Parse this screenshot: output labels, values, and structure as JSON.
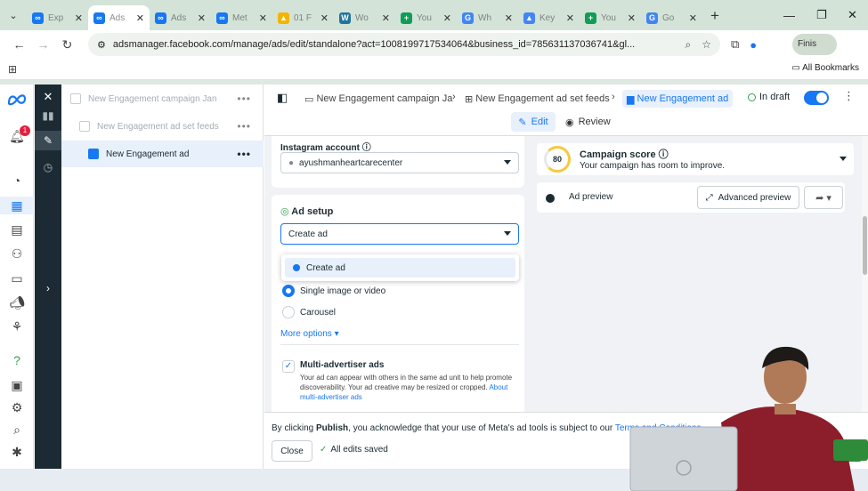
{
  "browser": {
    "tabs": [
      {
        "label": "Exp",
        "color": "#1877f2",
        "glyph": "∞"
      },
      {
        "label": "Ads",
        "color": "#1877f2",
        "glyph": "∞",
        "active": true
      },
      {
        "label": "Ads",
        "color": "#1877f2",
        "glyph": "∞"
      },
      {
        "label": "Met",
        "color": "#1877f2",
        "glyph": "∞"
      },
      {
        "label": "01 F",
        "color": "#f4b400",
        "glyph": "▲"
      },
      {
        "label": "Wo",
        "color": "#21759b",
        "glyph": "W"
      },
      {
        "label": "You",
        "color": "#0f9d58",
        "glyph": "+"
      },
      {
        "label": "Wh",
        "color": "#4285f4",
        "glyph": "G"
      },
      {
        "label": "Key",
        "color": "#4285f4",
        "glyph": "▲"
      },
      {
        "label": "You",
        "color": "#0f9d58",
        "glyph": "+"
      },
      {
        "label": "Go",
        "color": "#4285f4",
        "glyph": "G"
      }
    ],
    "url": "adsmanager.facebook.com/manage/ads/edit/standalone?act=1008199717534064&business_id=785631137036741&gl...",
    "finish_label": "Finis",
    "all_bookmarks": "All Bookmarks"
  },
  "tree": {
    "items": [
      {
        "label": "New Engagement campaign Jan"
      },
      {
        "label": "New Engagement ad set feeds"
      },
      {
        "label": "New Engagement ad"
      }
    ]
  },
  "nav": {
    "notification_count": "1"
  },
  "header": {
    "crumbs": [
      "New Engagement campaign Ja",
      "New Engagement ad set feeds",
      "New Engagement ad"
    ],
    "status": "In draft",
    "edit_tab": "Edit",
    "review_tab": "Review"
  },
  "form": {
    "instagram_label": "Instagram account",
    "instagram_value": "ayushmanheartcarecenter",
    "ad_setup_title": "Ad setup",
    "ad_setup_select": "Create ad",
    "dropdown_option": "Create ad",
    "format_single": "Single image or video",
    "format_carousel": "Carousel",
    "more_options": "More options",
    "multi_adv_label": "Multi-advertiser ads",
    "multi_adv_desc": "Your ad can appear with others in the same ad unit to help promote discoverability. Your ad creative may be resized or cropped.",
    "multi_adv_link": "About multi-advertiser ads"
  },
  "preview": {
    "score": "80",
    "score_title": "Campaign score",
    "score_sub": "Your campaign has room to improve.",
    "ad_preview": "Ad preview",
    "advanced_preview": "Advanced preview"
  },
  "footer": {
    "pre": "By clicking ",
    "bold": "Publish",
    "mid": ", you acknowledge that your use of Meta's ad tools is subject to our ",
    "link": "Terms and Conditions.",
    "close": "Close",
    "saved": "All edits saved",
    "publish": "h"
  },
  "colors": {
    "accent": "#1877f2",
    "success": "#31a24c",
    "dark_rail": "#1c2b33"
  }
}
